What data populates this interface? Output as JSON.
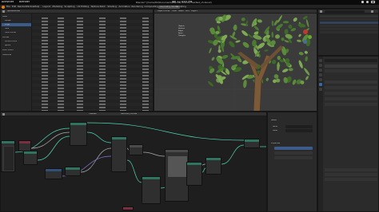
{
  "system_bar": {
    "activities": "Activities",
    "app": "Blender",
    "clock": "Jan 12  4:05 PM"
  },
  "window": {
    "title": "Blender* [/home/ttd/Documents/Blender/Scenes/TreeTest_v5.blend]"
  },
  "menu": {
    "items": [
      "File",
      "Edit",
      "Render",
      "Window",
      "Help"
    ]
  },
  "workspaces": {
    "tabs": [
      "Layout",
      "Modeling",
      "Sculpting",
      "UV Editing",
      "Texture Paint",
      "Shading",
      "Animation",
      "Rendering",
      "Compositing",
      "Geometry Nodes",
      "Scripting"
    ],
    "active_index": 9
  },
  "spreadsheet": {
    "header": "Spreadsheet",
    "sidebar_items": [
      "Mesh",
      "Vertex",
      "Edge",
      "Face",
      "Face Corner",
      "Curves",
      "Control Point",
      "Spline",
      "Point Cloud",
      "Instances"
    ],
    "columns": [
      "",
      "position",
      "",
      "",
      "",
      ""
    ]
  },
  "viewport": {
    "overlay_stats": [
      "Objects",
      "Vertices",
      "Edges",
      "Faces",
      "Triangles"
    ],
    "mode": "Object Mode",
    "menus": [
      "View",
      "Select",
      "Add",
      "Object"
    ]
  },
  "node_editor": {
    "header": "Geometry Nodes",
    "tree_name": "TreeGen"
  },
  "properties": {
    "search_placeholder": "",
    "sections": [
      "Transform",
      "Modifiers",
      "Geometry Nodes"
    ]
  },
  "node_side": {
    "title": "Node",
    "labels": [
      "Name",
      "Label",
      "Properties"
    ]
  },
  "colors": {
    "accent_teal": "#4fd6b6",
    "node_header_geo": "#2f7460",
    "active_tab": "#4b4b4b"
  }
}
